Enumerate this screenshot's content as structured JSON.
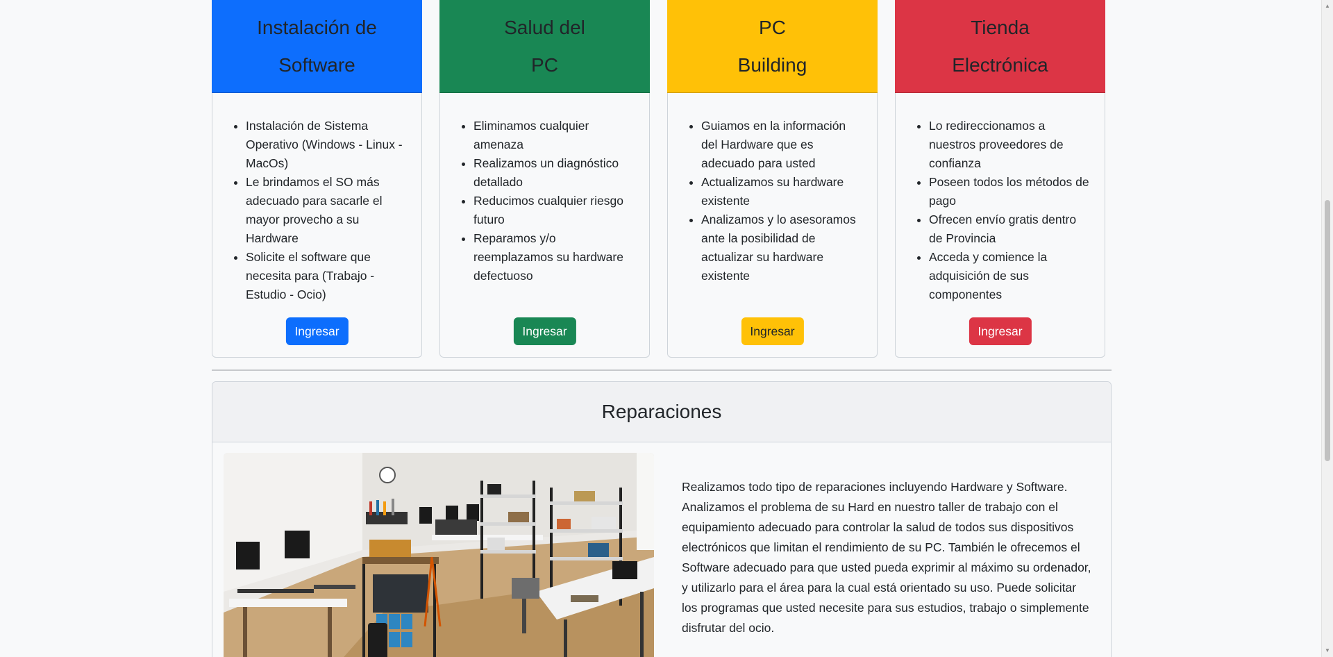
{
  "colors": {
    "primary": "#0d6efd",
    "success": "#198754",
    "warning": "#ffc107",
    "danger": "#dc3545",
    "page_bg": "#f8f9fa"
  },
  "cards": [
    {
      "title_line1": "Instalación de",
      "title_line2": "Software",
      "header_color": "#0d6efd",
      "items": [
        "Instalación de Sistema Operativo (Windows - Linux - MacOs)",
        "Le brindamos el SO más adecuado para sacarle el mayor provecho a su Hardware",
        "Solicite el software que necesita para (Trabajo - Estudio - Ocio)"
      ],
      "button_label": "Ingresar",
      "button_color": "#0d6efd",
      "button_text_color": "#ffffff"
    },
    {
      "title_line1": "Salud del",
      "title_line2": "PC",
      "header_color": "#198754",
      "items": [
        "Eliminamos cualquier amenaza",
        "Realizamos un diagnóstico detallado",
        "Reducimos cualquier riesgo futuro",
        "Reparamos y/o reemplazamos su hardware defectuoso"
      ],
      "button_label": "Ingresar",
      "button_color": "#198754",
      "button_text_color": "#ffffff"
    },
    {
      "title_line1": "PC",
      "title_line2": "Building",
      "header_color": "#ffc107",
      "items": [
        "Guiamos en la información del Hardware que es adecuado para usted",
        "Actualizamos su hardware existente",
        "Analizamos y lo asesoramos ante la posibilidad de actualizar su hardware existente"
      ],
      "button_label": "Ingresar",
      "button_color": "#ffc107",
      "button_text_color": "#212529"
    },
    {
      "title_line1": "Tienda",
      "title_line2": "Electrónica",
      "header_color": "#dc3545",
      "items": [
        "Lo redireccionamos a nuestros proveedores de confianza",
        "Poseen todos los métodos de pago",
        "Ofrecen envío gratis dentro de Provincia",
        "Acceda y comience la adquisición de sus componentes"
      ],
      "button_label": "Ingresar",
      "button_color": "#dc3545",
      "button_text_color": "#ffffff"
    }
  ],
  "repairs": {
    "title": "Reparaciones",
    "description": "Realizamos todo tipo de reparaciones incluyendo Hardware y Software. Analizamos el problema de su Hard en nuestro taller de trabajo con el equipamiento adecuado para controlar la salud de todos sus dispositivos electrónicos que limitan el rendimiento de su PC. También le ofrecemos el Software adecuado para que usted pueda exprimir al máximo su ordenador, y utilizarlo para el área para la cual está orientado su uso. Puede solicitar los programas que usted necesite para sus estudios, trabajo o simplemente disfrutar del ocio."
  }
}
